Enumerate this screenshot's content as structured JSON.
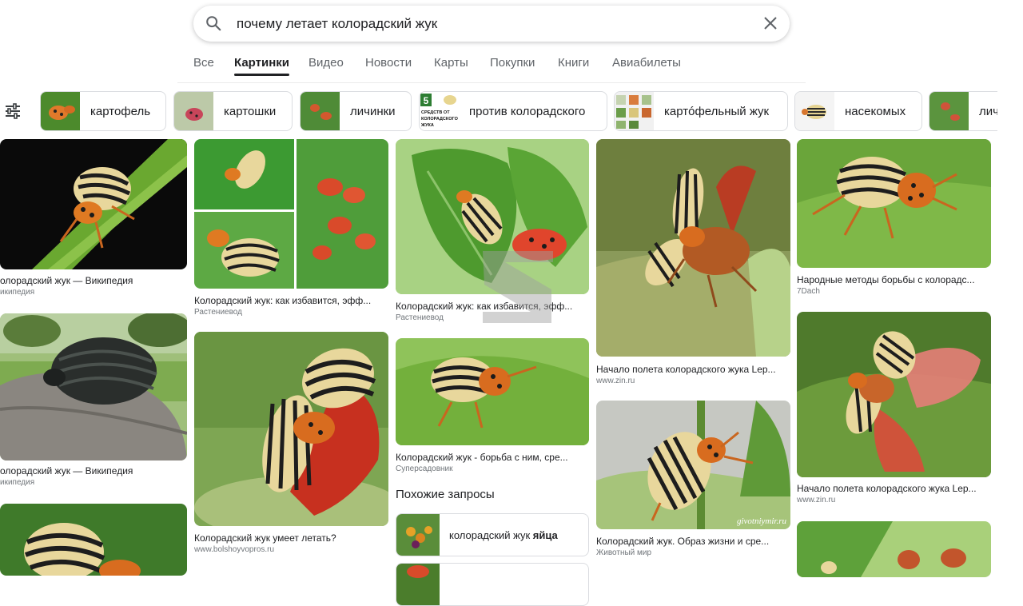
{
  "search": {
    "query": "почему летает колорадский жук",
    "icon": "search-icon",
    "clear_icon": "close-icon"
  },
  "tabs": [
    {
      "label": "Все",
      "active": false
    },
    {
      "label": "Картинки",
      "active": true
    },
    {
      "label": "Видео",
      "active": false
    },
    {
      "label": "Новости",
      "active": false
    },
    {
      "label": "Карты",
      "active": false
    },
    {
      "label": "Покупки",
      "active": false
    },
    {
      "label": "Книги",
      "active": false
    },
    {
      "label": "Авиабилеты",
      "active": false
    }
  ],
  "chips": [
    {
      "label": "картофель"
    },
    {
      "label": "картошки"
    },
    {
      "label": "личинки"
    },
    {
      "label": "против колорадского",
      "thumb_text": "5 СРЕДСТВ ОТ КОЛОРАДСКОГО ЖУКА"
    },
    {
      "label": "картóфельный жук"
    },
    {
      "label": "насекомых"
    },
    {
      "label": "личи"
    }
  ],
  "results": [
    {
      "title": "олорадский жук — Википедия",
      "source": "икипедия"
    },
    {
      "title": "олорадский жук — Википедия",
      "source": "икипедия"
    },
    {
      "title": "Колорадский жук: как избавится, эфф...",
      "source": "Растениевод"
    },
    {
      "title": "Колорадский жук умеет летать?",
      "source": "www.bolshoyvopros.ru"
    },
    {
      "title": "Колорадский жук: как избавится, эфф...",
      "source": "Растениевод"
    },
    {
      "title": "Колорадский жук - борьба с ним, сре...",
      "source": "Суперсадовник"
    },
    {
      "title": "Начало полета колорадского жука Lep...",
      "source": "www.zin.ru"
    },
    {
      "title": "Колорадский жук. Образ жизни и сре...",
      "source": "Животный мир"
    },
    {
      "title": "Народные методы борьбы с колорадс...",
      "source": "7Dach"
    },
    {
      "title": "Начало полета колорадского жука Lep...",
      "source": "www.zin.ru"
    }
  ],
  "watermark": "givotniymir.ru",
  "related": {
    "header": "Похожие запросы",
    "items": [
      {
        "prefix": "колорадский жук ",
        "bold": "яйца"
      }
    ]
  },
  "colors": {
    "beetle_stripe": "#f0e2a6",
    "beetle_orange": "#e0792a",
    "leaf_green": "#5fa33a",
    "active_tab": "#202124"
  }
}
